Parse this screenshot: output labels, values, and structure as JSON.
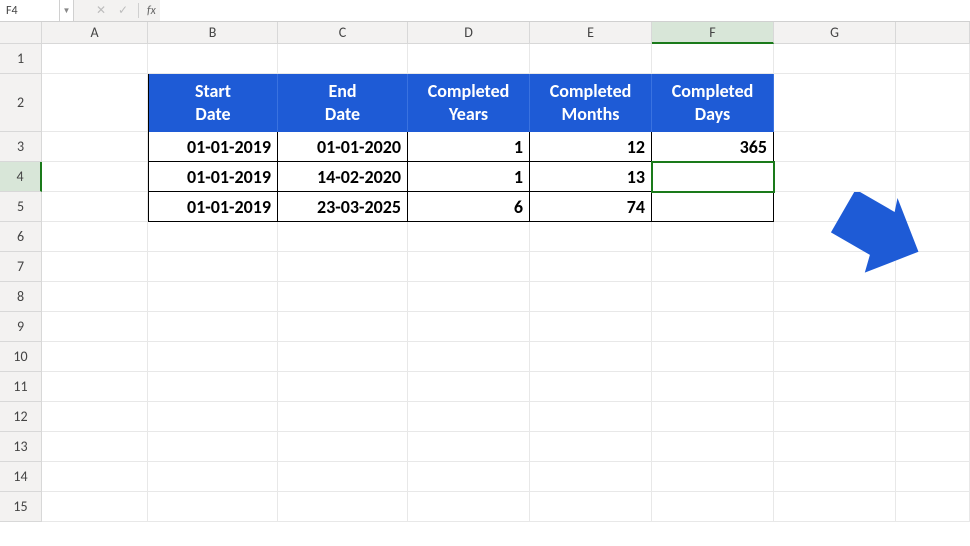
{
  "formula_bar": {
    "name_box": "F4",
    "fx_label": "fx",
    "formula": ""
  },
  "columns": [
    "A",
    "B",
    "C",
    "D",
    "E",
    "F",
    "G"
  ],
  "rows": [
    "1",
    "2",
    "3",
    "4",
    "5",
    "6",
    "7",
    "8",
    "9",
    "10",
    "11",
    "12",
    "13",
    "14",
    "15"
  ],
  "selected_cell": "F4",
  "headers": {
    "B2": "Start\nDate",
    "C2": "End\nDate",
    "D2": "Completed\nYears",
    "E2": "Completed\nMonths",
    "F2": "Completed\nDays"
  },
  "table": {
    "rows": [
      {
        "start": "01-01-2019",
        "end": "01-01-2020",
        "years": "1",
        "months": "12",
        "days": "365"
      },
      {
        "start": "01-01-2019",
        "end": "14-02-2020",
        "years": "1",
        "months": "13",
        "days": ""
      },
      {
        "start": "01-01-2019",
        "end": "23-03-2025",
        "years": "6",
        "months": "74",
        "days": ""
      }
    ]
  },
  "annotation": {
    "arrow_color": "#1e5bd6"
  }
}
